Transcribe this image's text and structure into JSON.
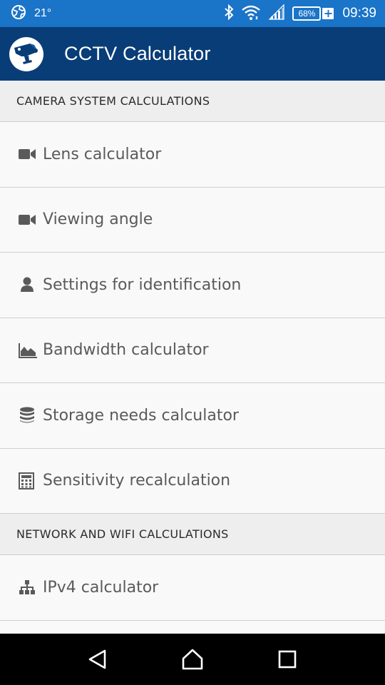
{
  "status_bar": {
    "temperature": "21°",
    "battery": "68%",
    "time": "09:39",
    "icons": [
      "weather-icon",
      "bluetooth-icon",
      "wifi-icon",
      "signal-icon",
      "battery-icon"
    ]
  },
  "app_bar": {
    "title": "CCTV Calculator",
    "logo_icon": "cctv-camera-logo"
  },
  "sections": [
    {
      "header": "CAMERA SYSTEM CALCULATIONS",
      "items": [
        {
          "label": "Lens calculator",
          "icon": "video-camera-icon"
        },
        {
          "label": "Viewing angle",
          "icon": "video-camera-icon"
        },
        {
          "label": "Settings for identification",
          "icon": "user-icon"
        },
        {
          "label": "Bandwidth calculator",
          "icon": "area-chart-icon"
        },
        {
          "label": "Storage needs calculator",
          "icon": "database-icon"
        },
        {
          "label": "Sensitivity recalculation",
          "icon": "calculator-icon"
        }
      ]
    },
    {
      "header": "NETWORK AND WIFI CALCULATIONS",
      "items": [
        {
          "label": "IPv4 calculator",
          "icon": "sitemap-icon"
        }
      ]
    }
  ],
  "colors": {
    "status_bar": "#1a74c8",
    "app_bar": "#093d77",
    "section_header_bg": "#eeeeee",
    "list_bg": "#f9f9f9",
    "icon": "#5a5a5a"
  }
}
